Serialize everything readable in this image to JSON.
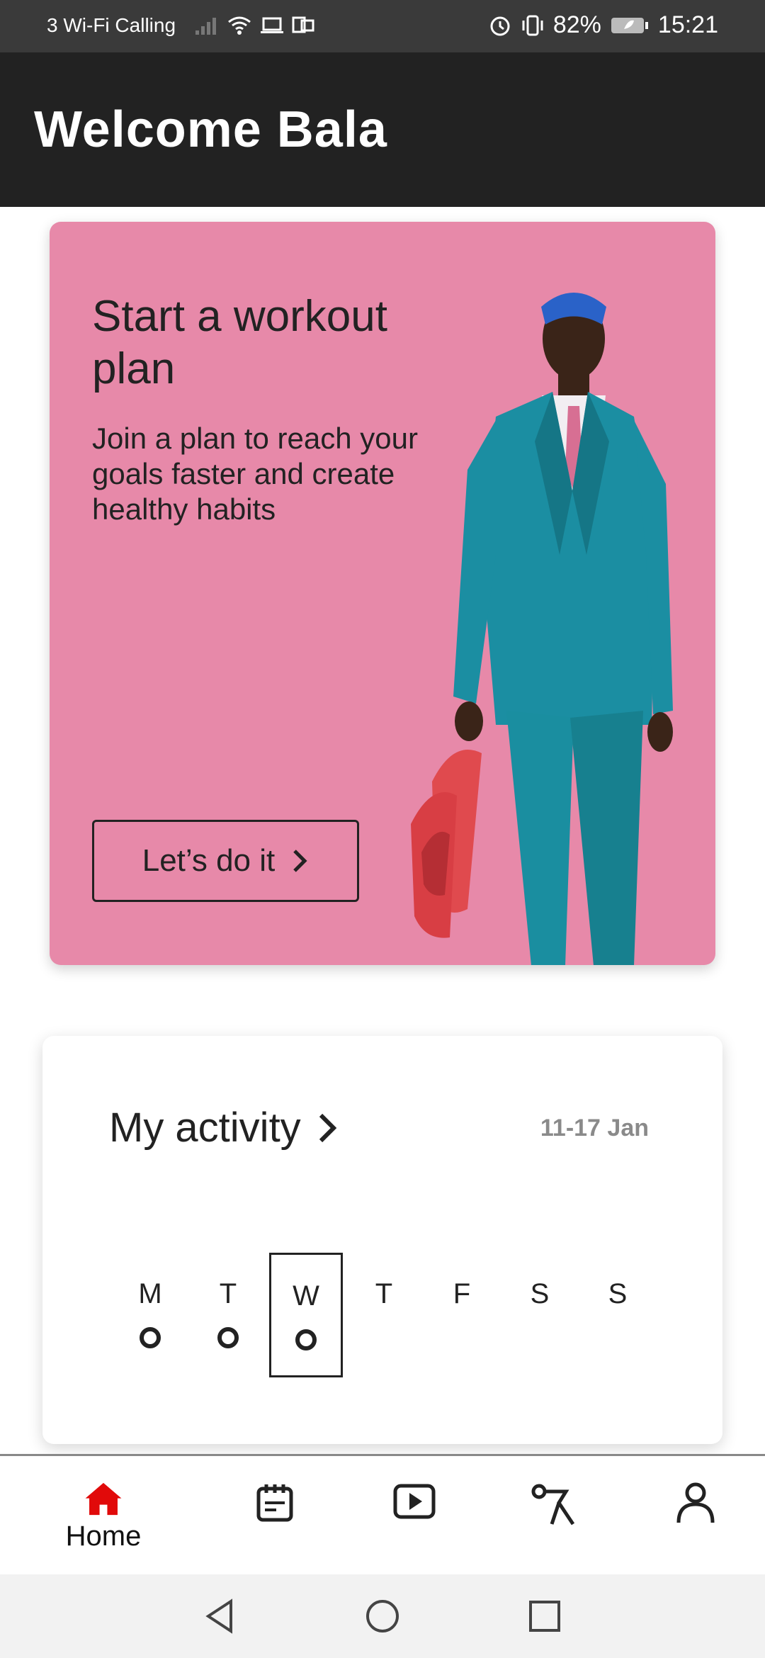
{
  "status_bar": {
    "carrier": "3 Wi-Fi Calling",
    "battery": "82%",
    "time": "15:21"
  },
  "header": {
    "title": "Welcome Bala"
  },
  "promo": {
    "title": "Start a workout plan",
    "subtitle": "Join a plan to reach your goals faster and create healthy habits",
    "button_label": "Let’s do it",
    "colors": {
      "background": "#e789a9",
      "text": "#222222"
    }
  },
  "activity": {
    "title": "My activity",
    "date_range": "11-17 Jan",
    "days": [
      {
        "label": "M",
        "has_dot": true,
        "active": false
      },
      {
        "label": "T",
        "has_dot": true,
        "active": false
      },
      {
        "label": "W",
        "has_dot": true,
        "active": true
      },
      {
        "label": "T",
        "has_dot": false,
        "active": false
      },
      {
        "label": "F",
        "has_dot": false,
        "active": false
      },
      {
        "label": "S",
        "has_dot": false,
        "active": false
      },
      {
        "label": "S",
        "has_dot": false,
        "active": false
      }
    ]
  },
  "bottom_nav": {
    "items": [
      {
        "label": "Home",
        "icon": "home-icon",
        "active": true
      },
      {
        "label": "",
        "icon": "calendar-icon",
        "active": false
      },
      {
        "label": "",
        "icon": "video-play-icon",
        "active": false
      },
      {
        "label": "",
        "icon": "exercise-icon",
        "active": false
      },
      {
        "label": "",
        "icon": "profile-icon",
        "active": false
      }
    ],
    "active_color": "#e10a0a"
  }
}
